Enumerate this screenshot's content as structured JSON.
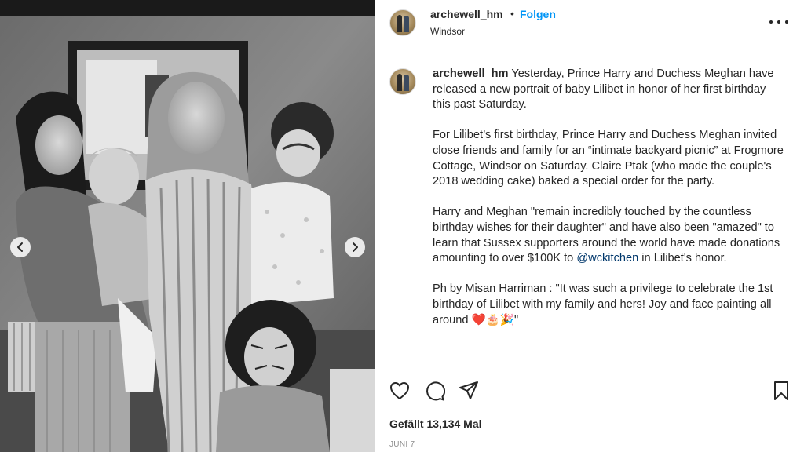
{
  "post": {
    "username": "archewell_hm",
    "follow_separator": "•",
    "follow_label": "Folgen",
    "location": "Windsor"
  },
  "photo": {
    "description_icon": "black-and-white-family-photo",
    "nav_prev_icon": "chevron-left-icon",
    "nav_next_icon": "chevron-right-icon"
  },
  "caption": {
    "username": "archewell_hm",
    "p1": "Yesterday, Prince Harry and Duchess Meghan have released a new portrait of baby Lilibet in honor of her first birthday this past Saturday.",
    "p2": "For Lilibet’s first birthday, Prince Harry and Duchess Meghan invited close friends and family for an “intimate backyard picnic” at Frogmore Cottage, Windsor on Saturday. Claire Ptak (who made the couple's 2018 wedding cake) baked a special order for the party.",
    "p3_before": "Harry and Meghan \"remain incredibly touched by the countless birthday wishes for their daughter\" and have also been \"amazed\" to learn that Sussex supporters around the world have made donations amounting to over $100K to ",
    "p3_mention": "@wckitchen",
    "p3_after": " in Lilibet's honor.",
    "p4": "Ph by Misan Harriman : \"It was such a privilege to celebrate the 1st birthday of Lilibet with my family and hers! Joy and face painting all around ",
    "p4_emojis": "❤️🎂🎉",
    "p4_end": "\""
  },
  "actions": {
    "like_icon": "heart-outline-icon",
    "comment_icon": "speech-bubble-icon",
    "share_icon": "paper-plane-icon",
    "save_icon": "bookmark-outline-icon"
  },
  "likes_text": "Gefällt 13,134 Mal",
  "date_text": "JUNI 7",
  "colors": {
    "link_blue": "#0095f6",
    "mention": "#00376b",
    "text": "#262626",
    "muted": "#8e8e8e"
  }
}
